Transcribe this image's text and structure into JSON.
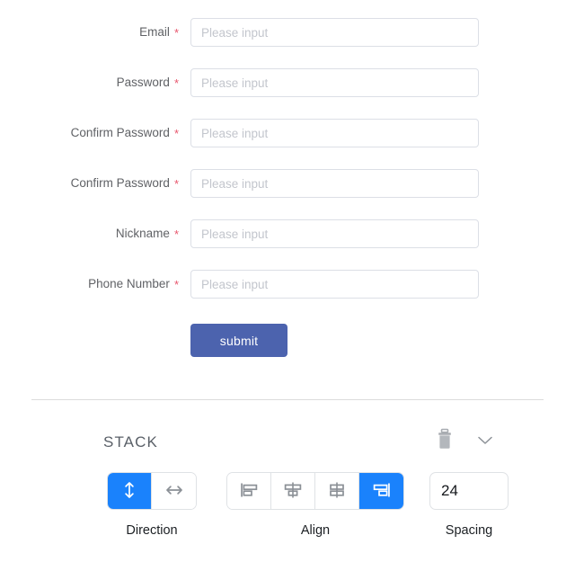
{
  "form": {
    "fields": [
      {
        "label": "Email",
        "required": true,
        "placeholder": "Please input",
        "value": ""
      },
      {
        "label": "Password",
        "required": true,
        "placeholder": "Please input",
        "value": ""
      },
      {
        "label": "Confirm Password",
        "required": true,
        "placeholder": "Please input",
        "value": ""
      },
      {
        "label": "Confirm Password",
        "required": true,
        "placeholder": "Please input",
        "value": ""
      },
      {
        "label": "Nickname",
        "required": true,
        "placeholder": "Please input",
        "value": ""
      },
      {
        "label": "Phone Number",
        "required": true,
        "placeholder": "Please input",
        "value": ""
      }
    ],
    "required_marker": "*",
    "submit_label": "submit",
    "submit_color": "#4c63ae"
  },
  "stack_panel": {
    "title": "STACK",
    "delete_icon": "trash-icon",
    "collapse_icon": "chevron-down-icon",
    "accent_color": "#1a82fc",
    "direction": {
      "label": "Direction",
      "options": [
        {
          "icon": "arrows-vertical-icon",
          "value": "vertical",
          "selected": true
        },
        {
          "icon": "arrows-horizontal-icon",
          "value": "horizontal",
          "selected": false
        }
      ]
    },
    "align": {
      "label": "Align",
      "options": [
        {
          "icon": "align-left-icon",
          "value": "start",
          "selected": false
        },
        {
          "icon": "align-center-icon",
          "value": "center",
          "selected": false
        },
        {
          "icon": "align-stretch-icon",
          "value": "middle",
          "selected": false
        },
        {
          "icon": "align-right-icon",
          "value": "end",
          "selected": true
        }
      ]
    },
    "spacing": {
      "label": "Spacing",
      "value": "24"
    }
  }
}
